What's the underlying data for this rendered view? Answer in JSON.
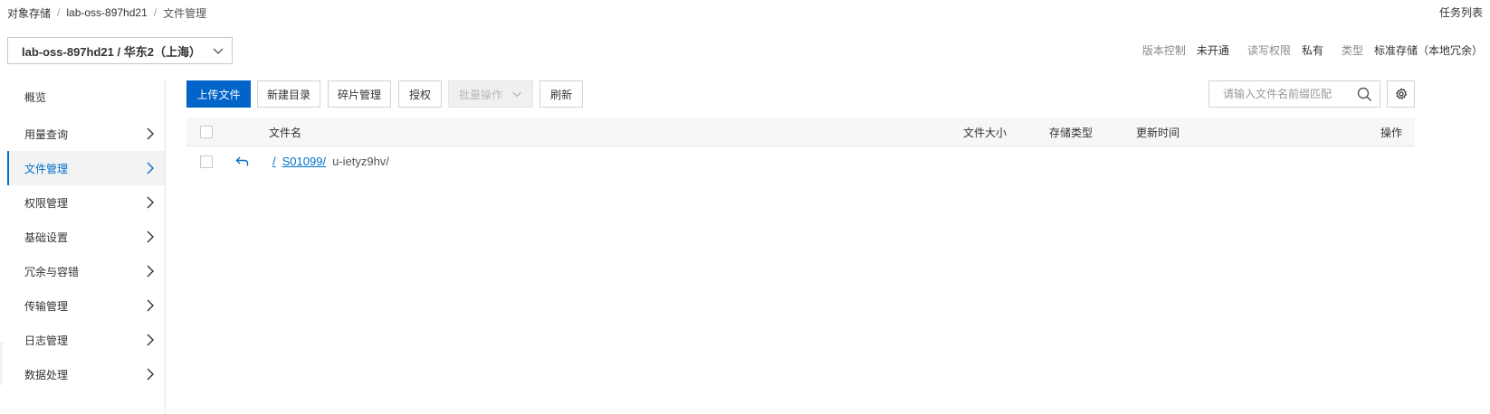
{
  "breadcrumb": {
    "items": [
      "对象存储",
      "lab-oss-897hd21",
      "文件管理"
    ],
    "separator": "/"
  },
  "header": {
    "task_list": "任务列表"
  },
  "bucket": {
    "selector_label": "lab-oss-897hd21 / 华东2（上海）",
    "info": {
      "versioning_label": "版本控制",
      "versioning_value": "未开通",
      "acl_label": "读写权限",
      "acl_value": "私有",
      "type_label": "类型",
      "type_value": "标准存储（本地冗余）"
    }
  },
  "sidebar": {
    "items": [
      {
        "label": "概览",
        "has_arrow": false
      },
      {
        "label": "用量查询",
        "has_arrow": true
      },
      {
        "label": "文件管理",
        "has_arrow": true,
        "active": true
      },
      {
        "label": "权限管理",
        "has_arrow": true
      },
      {
        "label": "基础设置",
        "has_arrow": true
      },
      {
        "label": "冗余与容错",
        "has_arrow": true
      },
      {
        "label": "传输管理",
        "has_arrow": true
      },
      {
        "label": "日志管理",
        "has_arrow": true
      },
      {
        "label": "数据处理",
        "has_arrow": true
      }
    ]
  },
  "toolbar": {
    "upload": "上传文件",
    "new_dir": "新建目录",
    "fragments": "碎片管理",
    "authorize": "授权",
    "batch": "批量操作",
    "refresh": "刷新"
  },
  "search": {
    "placeholder": "请输入文件名前缀匹配"
  },
  "table": {
    "columns": {
      "name": "文件名",
      "size": "文件大小",
      "storage_type": "存储类型",
      "updated": "更新时间",
      "actions": "操作"
    },
    "path": {
      "root": "/",
      "parent": "S01099/",
      "current": "u-ietyz9hv/"
    }
  },
  "colors": {
    "primary": "#0064c8",
    "link": "#0070cc",
    "border": "#d3d3d3",
    "header_bg": "#f7f7f7"
  }
}
